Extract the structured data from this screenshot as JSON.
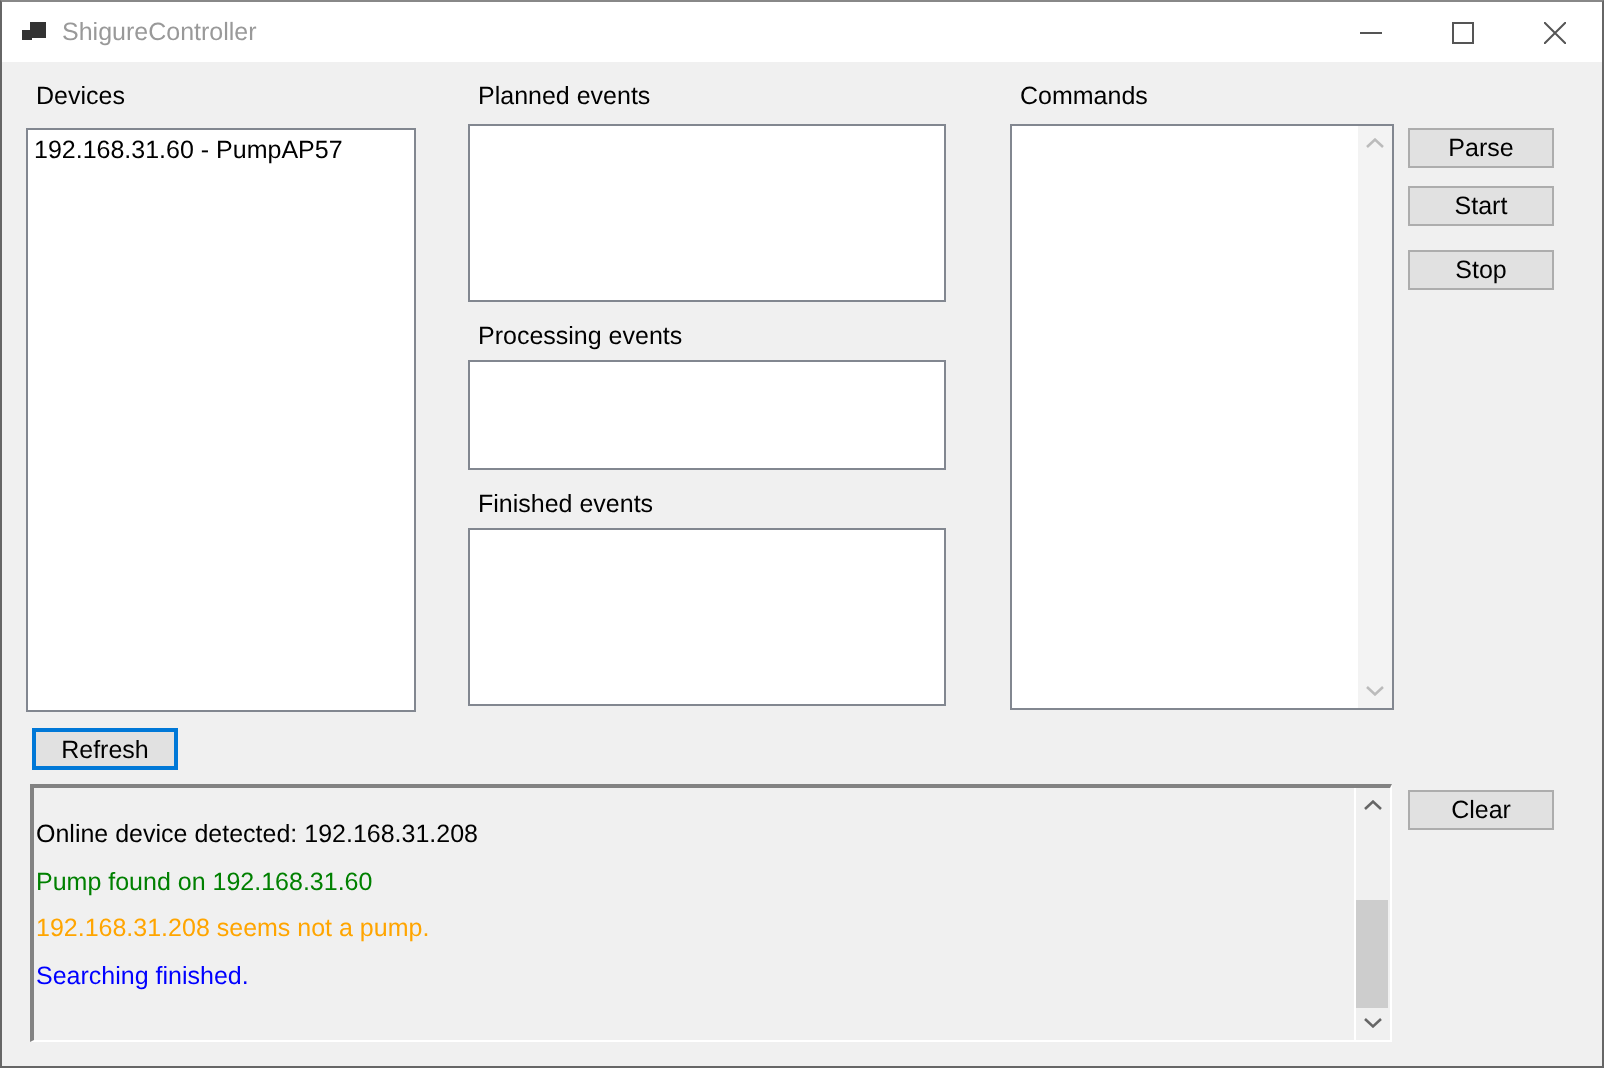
{
  "window": {
    "title": "ShigureController"
  },
  "devices": {
    "label": "Devices",
    "items": [
      "192.168.31.60 - PumpAP57"
    ]
  },
  "planned_events": {
    "label": "Planned events"
  },
  "processing_events": {
    "label": "Processing events"
  },
  "finished_events": {
    "label": "Finished events"
  },
  "commands": {
    "label": "Commands"
  },
  "command_buttons": [
    "Parse",
    "Start",
    "Stop"
  ],
  "refresh_button": "Refresh",
  "log": [
    {
      "text": "Online device detected: 192.168.31.208",
      "color": "#000000"
    },
    {
      "text": "Pump found on 192.168.31.60",
      "color": "#008000"
    },
    {
      "text": "192.168.31.208 seems not a pump.",
      "color": "#ffa500"
    },
    {
      "text": "Searching finished.",
      "color": "#0000ff"
    }
  ],
  "clear_button": "Clear"
}
